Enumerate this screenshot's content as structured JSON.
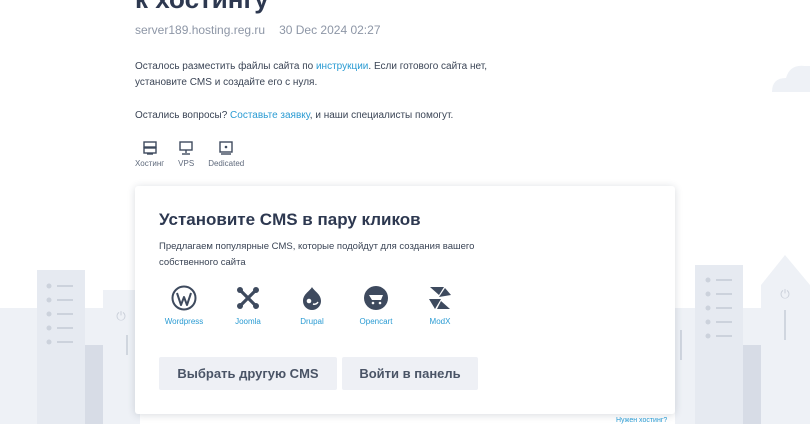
{
  "header": {
    "title": "к хостингу",
    "server": "server189.hosting.reg.ru",
    "datetime": "30 Dec 2024 02:27"
  },
  "intro": {
    "text_before_link": "Осталось разместить файлы сайта по ",
    "link_instructions": "инструкции",
    "text_after_link": ". Если готового сайта нет, установите CMS и создайте его с нуля."
  },
  "questions": {
    "text_before_link": "Остались вопросы? ",
    "link_request": "Составьте заявку",
    "text_after_link": ", и наши специалисты помогут."
  },
  "hosting_types": [
    {
      "label": "Хостинг",
      "icon": "hosting-icon"
    },
    {
      "label": "VPS",
      "icon": "vps-icon"
    },
    {
      "label": "Dedicated",
      "icon": "dedicated-icon"
    }
  ],
  "card": {
    "title": "Установите CMS в пару кликов",
    "subtitle": "Предлагаем популярные CMS, которые подойдут для создания вашего собственного сайта",
    "cms": [
      {
        "label": "Wordpress",
        "icon": "wordpress-icon"
      },
      {
        "label": "Joomla",
        "icon": "joomla-icon"
      },
      {
        "label": "Drupal",
        "icon": "drupal-icon"
      },
      {
        "label": "Opencart",
        "icon": "opencart-icon"
      },
      {
        "label": "ModX",
        "icon": "modx-icon"
      }
    ],
    "choose_button": "Выбрать другую CMS",
    "panel_button": "Войти в панель"
  },
  "footer": {
    "need_hosting_link": "Нужен хостинг?"
  },
  "colors": {
    "link": "#2a9bd3",
    "title": "#2d3850",
    "button_bg": "#eef0f5",
    "icon_dark": "#3e4a5e"
  }
}
